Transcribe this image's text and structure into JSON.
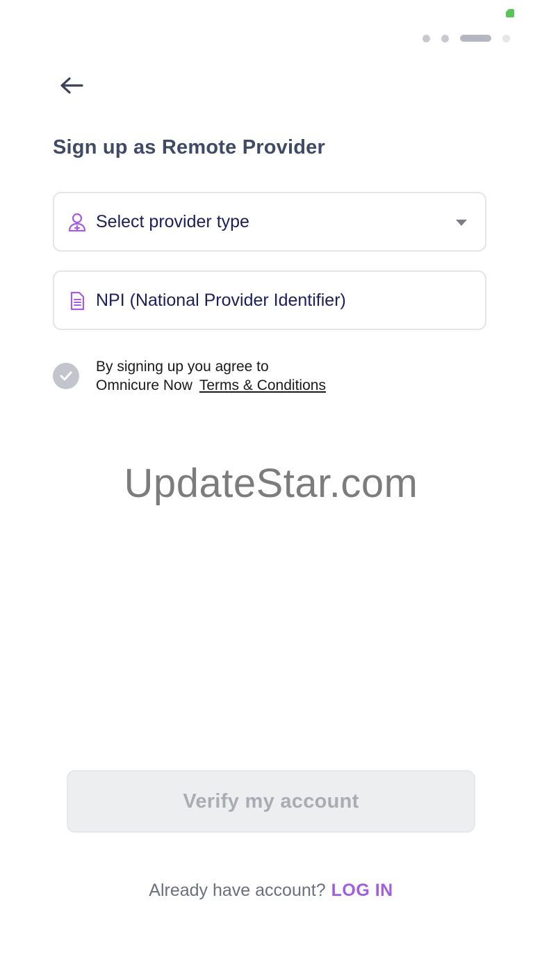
{
  "status_bar": {
    "battery_color": "#5ac35a"
  },
  "progress": {
    "steps": 4,
    "current_step": 3
  },
  "header": {
    "back_icon": "arrow-left-icon",
    "title": "Sign up as Remote Provider"
  },
  "form": {
    "provider_type": {
      "icon": "user-plus-icon",
      "placeholder": "Select provider type"
    },
    "npi": {
      "icon": "document-icon",
      "placeholder": "NPI (National Provider Identifier)"
    },
    "agreement": {
      "checked": true,
      "line1": "By signing up you agree to",
      "line2": "Omnicure Now",
      "link": "Terms & Conditions"
    }
  },
  "watermark": "UpdateStar.com",
  "actions": {
    "verify_label": "Verify my account"
  },
  "footer": {
    "prompt": "Already have account?",
    "login_label": "LOG IN"
  },
  "colors": {
    "accent": "#a35ee0",
    "title": "#3f4a66",
    "field_text": "#1b1f5c",
    "disabled_button_bg": "#edeef0"
  }
}
